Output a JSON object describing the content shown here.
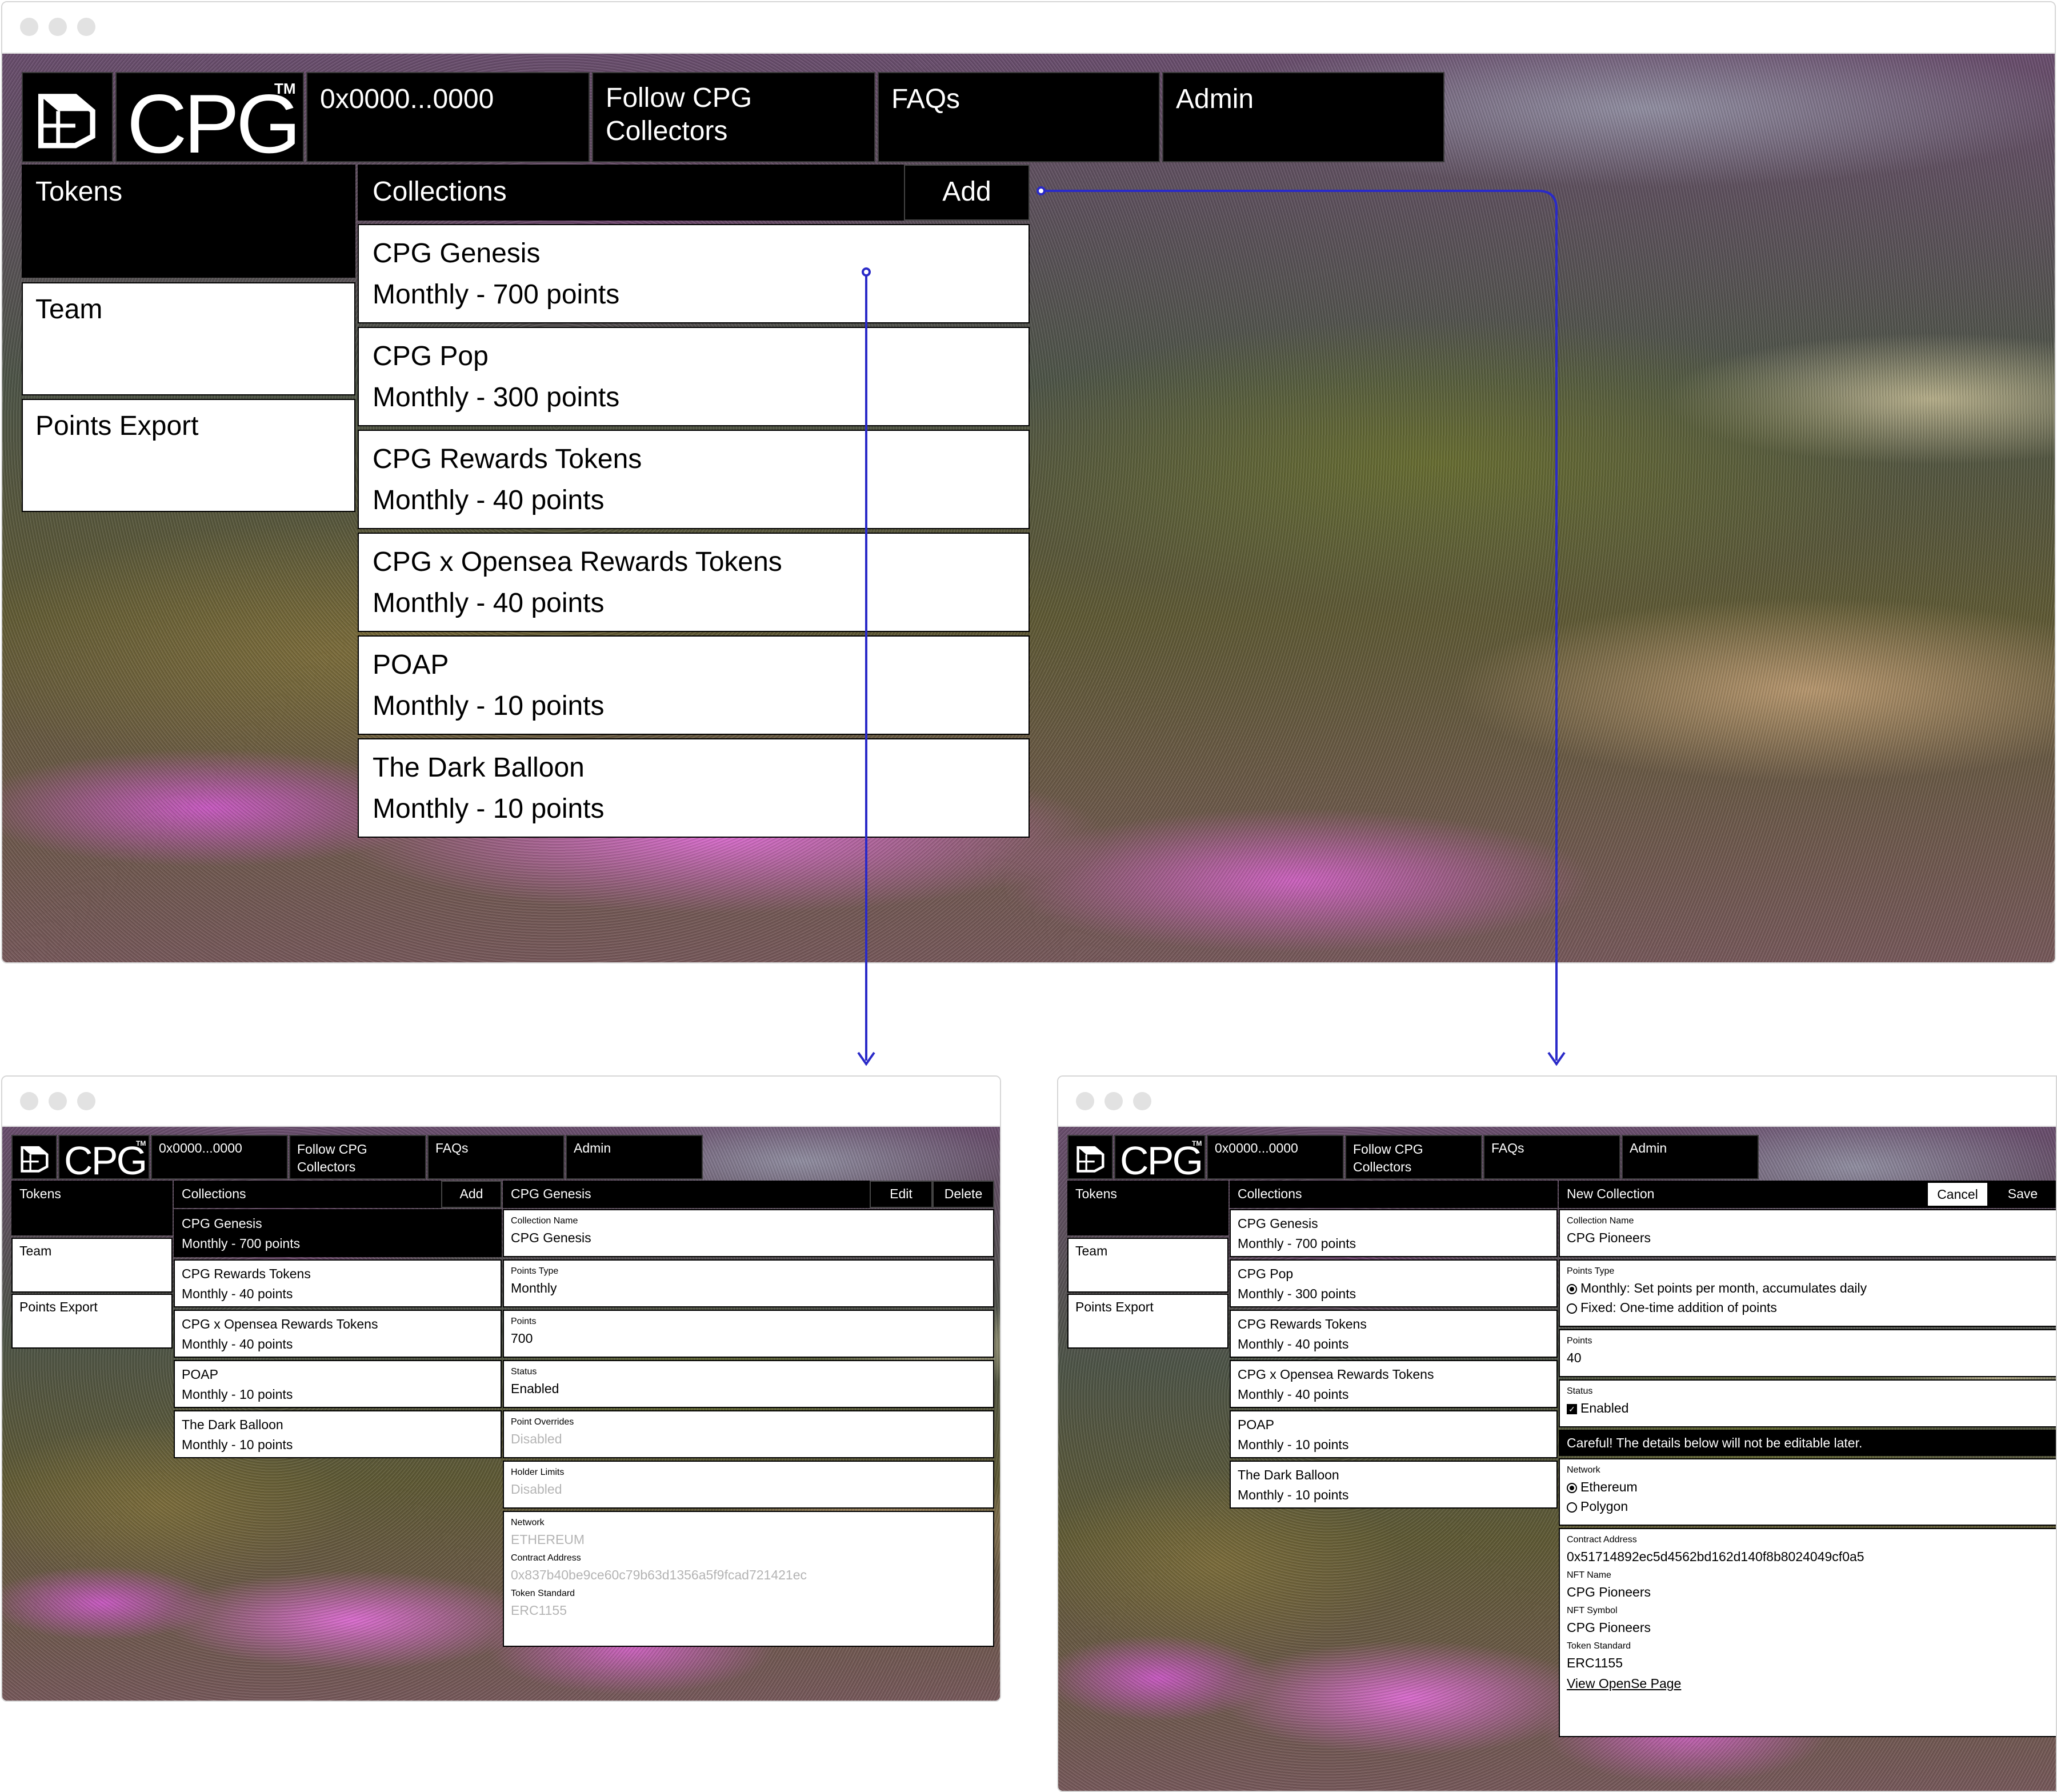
{
  "brand": {
    "logo_text": "CPG",
    "trademark": "TM"
  },
  "nav": {
    "wallet": "0x0000...0000",
    "follow_line1": "Follow CPG",
    "follow_line2": "Collectors",
    "faqs": "FAQs",
    "admin": "Admin"
  },
  "sidebar": {
    "tokens": "Tokens",
    "team": "Team",
    "points_export": "Points Export"
  },
  "collections": {
    "header": "Collections",
    "add": "Add",
    "items": [
      {
        "name": "CPG Genesis",
        "detail": "Monthly - 700 points"
      },
      {
        "name": "CPG Pop",
        "detail": "Monthly - 300 points"
      },
      {
        "name": "CPG Rewards Tokens",
        "detail": "Monthly - 40 points"
      },
      {
        "name": "CPG x Opensea Rewards Tokens",
        "detail": "Monthly - 40 points"
      },
      {
        "name": "POAP",
        "detail": "Monthly - 10 points"
      },
      {
        "name": "The Dark Balloon",
        "detail": "Monthly - 10 points"
      }
    ]
  },
  "detail_view": {
    "title": "CPG Genesis",
    "edit": "Edit",
    "delete": "Delete",
    "collection_name_label": "Collection Name",
    "collection_name": "CPG Genesis",
    "points_type_label": "Points Type",
    "points_type": "Monthly",
    "points_label": "Points",
    "points": "700",
    "status_label": "Status",
    "status": "Enabled",
    "point_overrides_label": "Point Overrides",
    "point_overrides": "Disabled",
    "holder_limits_label": "Holder Limits",
    "holder_limits": "Disabled",
    "network_label": "Network",
    "network": "ETHEREUM",
    "contract_label": "Contract Address",
    "contract": "0x837b40be9ce60c79b63d1356a5f9fcad721421ec",
    "standard_label": "Token Standard",
    "standard": "ERC1155"
  },
  "new_view": {
    "title": "New Collection",
    "cancel": "Cancel",
    "save": "Save",
    "collection_name_label": "Collection Name",
    "collection_name": "CPG Pioneers",
    "points_type_label": "Points Type",
    "points_type_monthly": "Monthly: Set points per month, accumulates daily",
    "points_type_fixed": "Fixed: One-time addition of points",
    "points_label": "Points",
    "points": "40",
    "status_label": "Status",
    "status": "Enabled",
    "warning": "Careful! The details below will not be editable later.",
    "network_label": "Network",
    "network_ethereum": "Ethereum",
    "network_polygon": "Polygon",
    "contract_label": "Contract Address",
    "contract": "0x51714892ec5d4562bd162d140f8b8024049cf0a5",
    "nft_name_label": "NFT Name",
    "nft_name": "CPG Pioneers",
    "nft_symbol_label": "NFT Symbol",
    "nft_symbol": "CPG Pioneers",
    "standard_label": "Token Standard",
    "standard": "ERC1155",
    "view_link": "View OpenSe Page"
  },
  "colors": {
    "connector": "#2a2ac8",
    "panel_black": "#000000",
    "panel_white": "#ffffff"
  }
}
